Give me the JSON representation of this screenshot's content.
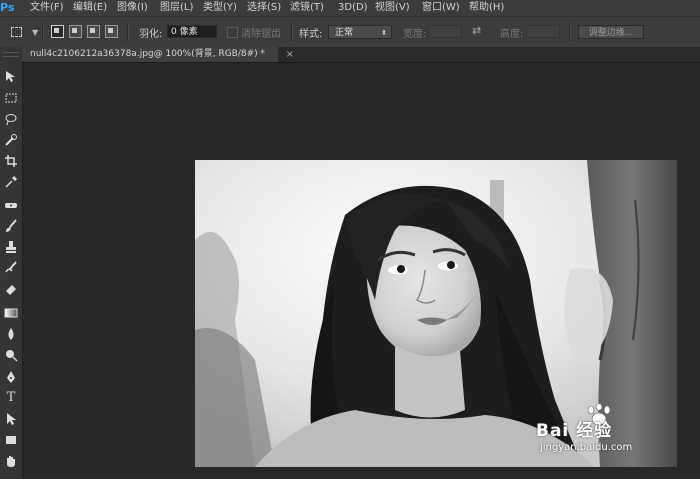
{
  "app": {
    "logo": "Ps"
  },
  "menu": {
    "items": [
      {
        "label": "文件(F)"
      },
      {
        "label": "编辑(E)"
      },
      {
        "label": "图像(I)"
      },
      {
        "label": "图层(L)"
      },
      {
        "label": "类型(Y)"
      },
      {
        "label": "选择(S)"
      },
      {
        "label": "滤镜(T)"
      },
      {
        "label": "3D(D)"
      },
      {
        "label": "视图(V)"
      },
      {
        "label": "窗口(W)"
      },
      {
        "label": "帮助(H)"
      }
    ]
  },
  "options": {
    "feather_label": "羽化:",
    "feather_value": "0 像素",
    "antialias_label": "消除锯齿",
    "style_label": "样式:",
    "style_value": "正常",
    "width_label": "宽度:",
    "height_label": "高度:",
    "refine_edge_label": "调整边缘..."
  },
  "document": {
    "tab_title": "null4c2106212a36378a.jpg@ 100%(背景, RGB/8#) *",
    "close_glyph": "×"
  },
  "watermark": {
    "brand": "Bai 经验",
    "url": "jingyan.baidu.com"
  },
  "icons": {
    "toolbar": [
      "move-icon",
      "rect-marquee-icon",
      "lasso-icon",
      "quick-select-icon",
      "crop-icon",
      "eyedropper-icon",
      "healing-brush-icon",
      "brush-icon",
      "clone-stamp-icon",
      "history-brush-icon",
      "eraser-icon",
      "gradient-icon",
      "blur-icon",
      "dodge-icon",
      "pen-icon",
      "type-icon",
      "path-select-icon",
      "rectangle-shape-icon",
      "hand-icon"
    ]
  },
  "colors": {
    "menubar_bg": "#3c3c3c",
    "workspace_bg": "#282828",
    "accent": "#31a8ff"
  }
}
